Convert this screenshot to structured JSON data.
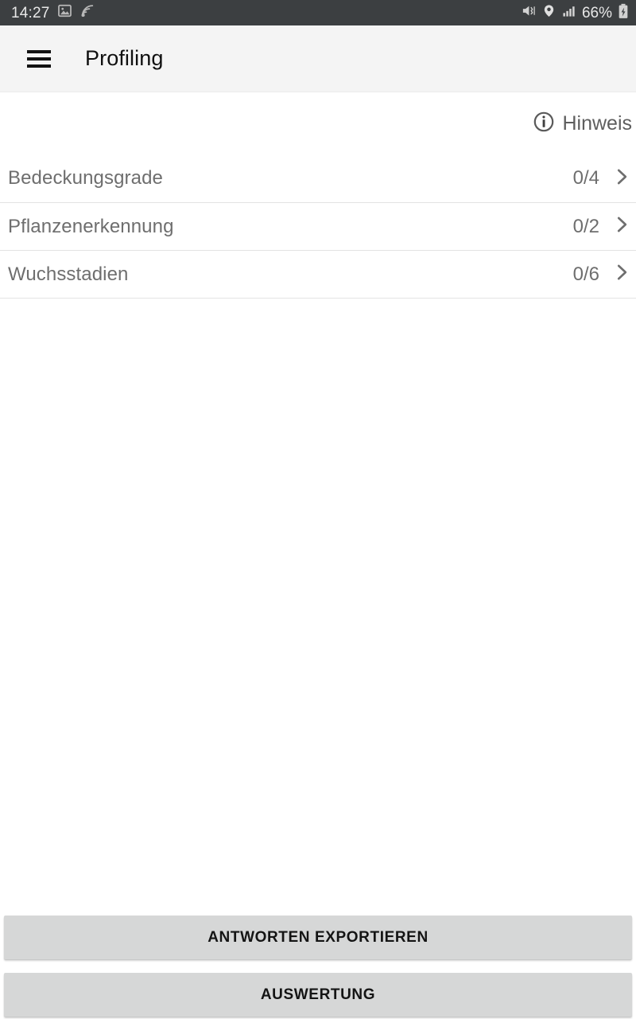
{
  "statusbar": {
    "time": "14:27",
    "battery_percent": "66%",
    "icons_left": [
      "photo-icon",
      "cast-icon"
    ],
    "icons_right": [
      "mute-vibrate-icon",
      "location-pin-icon",
      "signal-bars-icon",
      "battery-charging-icon"
    ],
    "background_color": "#3c3f41",
    "text_color": "#e8e8e8"
  },
  "appbar": {
    "menu_icon": "hamburger-menu-icon",
    "title": "Profiling",
    "background_color": "#f4f4f4"
  },
  "hint": {
    "icon": "info-circle-icon",
    "label": "Hinweis"
  },
  "list": {
    "items": [
      {
        "label": "Bedeckungsgrade",
        "count": "0/4",
        "chevron": "chevron-right-icon"
      },
      {
        "label": "Pflanzenerkennung",
        "count": "0/2",
        "chevron": "chevron-right-icon"
      },
      {
        "label": "Wuchsstadien",
        "count": "0/6",
        "chevron": "chevron-right-icon"
      }
    ]
  },
  "bottom_actions": {
    "export_label": "ANTWORTEN EXPORTIEREN",
    "evaluation_label": "AUSWERTUNG",
    "button_color": "#d6d7d7"
  }
}
